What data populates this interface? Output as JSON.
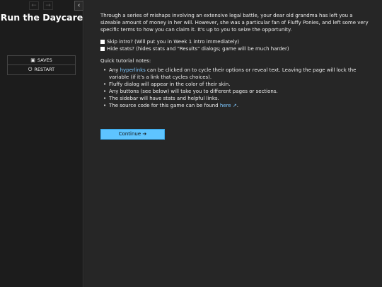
{
  "sidebar": {
    "history_back_icon": "←",
    "history_forward_icon": "→",
    "toggle_icon": "‹",
    "title": "Run the Daycare",
    "saves_icon": "💾",
    "saves_label": "SAVES",
    "restart_icon": "⏻",
    "restart_label": "RESTART"
  },
  "passage": {
    "intro": "Through a series of mishaps involving an extensive legal battle, your dear old grandma has left you a sizeable amount of money in her will. However, she was a particular fan of Fluffy Ponies, and left some very specific terms to how you can claim it. It's up to you to seize the opportunity.",
    "option_skip": "Skip intro? (Will put you in Week 1 intro immediately)",
    "option_hide": "Hide stats? (hides stats and \"Results\" dialogs; game will be much harder)",
    "tips_heading": "Quick tutorial notes:",
    "tip1_pre": "Any ",
    "tip1_link": "hyperlinks",
    "tip1_post": " can be clicked on to cycle their options or reveal text. Leaving the page will lock the variable (if it's a link that cycles choices).",
    "tip2": "Fluffy dialog will appear in the color of their skin.",
    "tip3": "Any buttons (see below) will take you to different pages or sections.",
    "tip4": "The sidebar will have stats and helpful links.",
    "tip5_pre": "The source code for this game can be found ",
    "tip5_link": "here",
    "tip5_icon": "↗",
    "tip5_post": ".",
    "continue_label": "Continue",
    "continue_icon": "➔"
  }
}
